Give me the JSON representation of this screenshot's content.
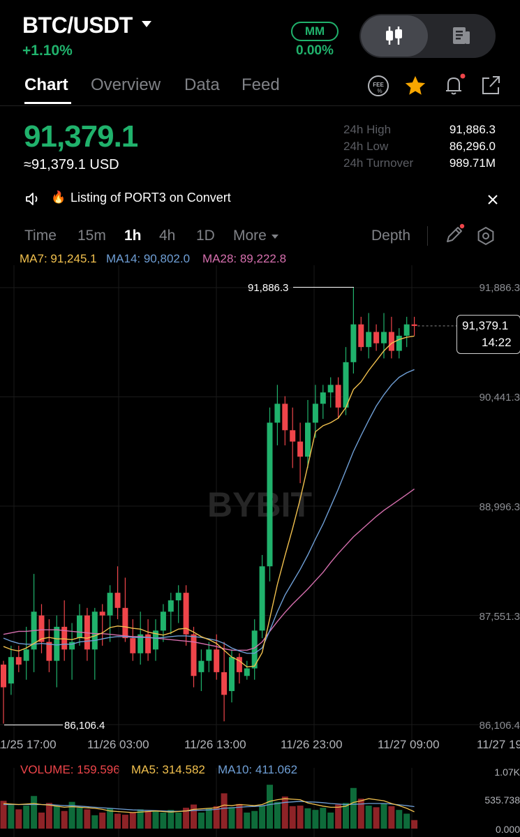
{
  "header": {
    "pair": "BTC/USDT",
    "change": "+1.10%",
    "mm_label": "MM",
    "mm_value": "0.00%"
  },
  "tabs": [
    {
      "label": "Chart"
    },
    {
      "label": "Overview"
    },
    {
      "label": "Data"
    },
    {
      "label": "Feed"
    }
  ],
  "ticker": {
    "last_price": "91,379.1",
    "usd_price": "≈91,379.1 USD",
    "high_label": "24h High",
    "high_value": "91,886.3",
    "low_label": "24h Low",
    "low_value": "86,296.0",
    "turnover_label": "24h Turnover",
    "turnover_value": "989.71M"
  },
  "notice": {
    "text": "Listing of PORT3 on Convert",
    "fire_icon": "🔥"
  },
  "timeframes": {
    "items": [
      "Time",
      "15m",
      "1h",
      "4h",
      "1D",
      "More"
    ],
    "selected": "1h",
    "depth_label": "Depth"
  },
  "ma": {
    "ma7": "MA7: 91,245.1",
    "ma14": "MA14: 90,802.0",
    "ma28": "MA28: 89,222.8"
  },
  "colors": {
    "up": "#20b26c",
    "down": "#ef454a",
    "ma7": "#f2c14e",
    "ma14": "#6f9fd6",
    "ma28": "#d66fae",
    "vol_up": "#0e6b3a",
    "vol_down": "#8e2327"
  },
  "chart_data": {
    "type": "candlestick",
    "y_ticks": [
      "91,886.3",
      "90,441.3",
      "88,996.3",
      "87,551.3",
      "86,106.4"
    ],
    "x_ticks": [
      "11/25 17:00",
      "11/26 03:00",
      "11/26 13:00",
      "11/26 23:00",
      "11/27 09:00",
      "11/27 19"
    ],
    "ylim": [
      86106.4,
      91886.3
    ],
    "max_label": "91,886.3",
    "min_label": "86,106.4",
    "last_price_label": "91,379.1",
    "countdown": "14:22",
    "watermark": "BYBIT",
    "candles": [
      [
        86900,
        86950,
        86120,
        86600
      ],
      [
        86650,
        87150,
        86500,
        87000
      ],
      [
        87000,
        87150,
        86800,
        86900
      ],
      [
        86950,
        87400,
        86700,
        87100
      ],
      [
        87100,
        88100,
        86800,
        87600
      ],
      [
        87550,
        87700,
        87050,
        87200
      ],
      [
        87200,
        87500,
        86800,
        86950
      ],
      [
        86950,
        87550,
        86600,
        87400
      ],
      [
        87400,
        87750,
        86950,
        87100
      ],
      [
        87100,
        87450,
        86700,
        87200
      ],
      [
        87250,
        87700,
        87150,
        87550
      ],
      [
        87550,
        87650,
        86950,
        87100
      ],
      [
        87100,
        87650,
        86700,
        87600
      ],
      [
        87600,
        87700,
        87150,
        87550
      ],
      [
        87550,
        87950,
        87200,
        87850
      ],
      [
        87850,
        88200,
        87500,
        87650
      ],
      [
        87650,
        88050,
        87200,
        87250
      ],
      [
        87250,
        87500,
        86950,
        87050
      ],
      [
        87050,
        87600,
        86900,
        87300
      ],
      [
        87300,
        87500,
        86950,
        87050
      ],
      [
        87100,
        87500,
        86950,
        87350
      ],
      [
        87350,
        87700,
        87200,
        87600
      ],
      [
        87600,
        87850,
        87300,
        87750
      ],
      [
        87750,
        87950,
        87450,
        87850
      ],
      [
        87850,
        87950,
        87150,
        87300
      ],
      [
        87300,
        87400,
        86600,
        86750
      ],
      [
        86800,
        87100,
        86550,
        86950
      ],
      [
        86950,
        87200,
        86800,
        87100
      ],
      [
        87100,
        87300,
        86700,
        86800
      ],
      [
        86800,
        87200,
        86150,
        86500
      ],
      [
        86550,
        87100,
        86400,
        87000
      ],
      [
        87000,
        87050,
        86650,
        86800
      ],
      [
        86750,
        86950,
        86700,
        86850
      ],
      [
        86850,
        87500,
        86700,
        87350
      ],
      [
        87350,
        88350,
        87250,
        88200
      ],
      [
        88200,
        90300,
        88000,
        90100
      ],
      [
        90100,
        90600,
        89800,
        90350
      ],
      [
        90350,
        90450,
        89800,
        90000
      ],
      [
        90000,
        90300,
        89500,
        89850
      ],
      [
        89850,
        90100,
        89300,
        89650
      ],
      [
        89650,
        90400,
        89500,
        90100
      ],
      [
        90100,
        90600,
        89900,
        90350
      ],
      [
        90350,
        90600,
        90150,
        90500
      ],
      [
        90500,
        90700,
        90300,
        90600
      ],
      [
        90600,
        90700,
        90150,
        90300
      ],
      [
        90300,
        91100,
        90200,
        90900
      ],
      [
        90900,
        91886.3,
        90750,
        91400
      ],
      [
        91400,
        91500,
        91050,
        91100
      ],
      [
        91100,
        91550,
        90950,
        91300
      ],
      [
        91300,
        91400,
        91050,
        91150
      ],
      [
        91150,
        91550,
        90950,
        91300
      ],
      [
        91300,
        91500,
        90950,
        91050
      ],
      [
        91050,
        91350,
        90950,
        91250
      ],
      [
        91250,
        91500,
        91100,
        91400
      ],
      [
        91400,
        91500,
        91250,
        91379.1
      ]
    ],
    "ma7": [
      87140,
      87100,
      87080,
      87120,
      87180,
      87240,
      87260,
      87240,
      87240,
      87230,
      87260,
      87250,
      87280,
      87320,
      87390,
      87410,
      87400,
      87380,
      87370,
      87330,
      87310,
      87290,
      87320,
      87370,
      87380,
      87330,
      87270,
      87230,
      87180,
      87090,
      87000,
      86950,
      86870,
      86880,
      87060,
      87510,
      87960,
      88340,
      88700,
      89090,
      89530,
      89980,
      90060,
      90100,
      90160,
      90300,
      90540,
      90640,
      90790,
      90920,
      91050,
      91150,
      91200,
      91230,
      91245.1
    ],
    "ma14": [
      87250,
      87210,
      87180,
      87170,
      87170,
      87180,
      87170,
      87160,
      87170,
      87170,
      87200,
      87210,
      87220,
      87240,
      87260,
      87270,
      87270,
      87260,
      87260,
      87260,
      87250,
      87260,
      87270,
      87280,
      87280,
      87270,
      87260,
      87240,
      87220,
      87180,
      87120,
      87080,
      87050,
      87050,
      87120,
      87350,
      87600,
      87820,
      87990,
      88160,
      88350,
      88560,
      88760,
      88990,
      89220,
      89470,
      89720,
      89930,
      90130,
      90320,
      90470,
      90600,
      90700,
      90760,
      90802.0
    ],
    "ma28": [
      87300,
      87320,
      87340,
      87340,
      87350,
      87360,
      87360,
      87360,
      87350,
      87340,
      87330,
      87320,
      87310,
      87310,
      87300,
      87290,
      87280,
      87270,
      87270,
      87260,
      87250,
      87240,
      87230,
      87220,
      87210,
      87200,
      87180,
      87160,
      87140,
      87110,
      87090,
      87090,
      87090,
      87120,
      87200,
      87340,
      87470,
      87590,
      87700,
      87800,
      87900,
      88010,
      88120,
      88250,
      88370,
      88480,
      88590,
      88680,
      88770,
      88860,
      88940,
      89010,
      89080,
      89150,
      89222.8
    ]
  },
  "volume": {
    "volume_label": "VOLUME: 159.596",
    "ma5_label": "MA5: 314.582",
    "ma10_label": "MA10: 411.062",
    "y_ticks": [
      "1.07K",
      "535.738",
      "0.000"
    ],
    "ylim": [
      0,
      1070
    ],
    "values": [
      520,
      440,
      360,
      430,
      610,
      300,
      480,
      420,
      330,
      500,
      390,
      360,
      250,
      300,
      380,
      280,
      260,
      300,
      360,
      330,
      320,
      300,
      350,
      300,
      390,
      450,
      300,
      380,
      420,
      660,
      400,
      460,
      300,
      330,
      430,
      820,
      500,
      600,
      420,
      430,
      380,
      350,
      390,
      300,
      450,
      480,
      760,
      560,
      430,
      400,
      470,
      420,
      350,
      280,
      159.596
    ],
    "ma5": [
      470,
      460,
      450,
      460,
      470,
      450,
      440,
      420,
      400,
      410,
      400,
      390,
      380,
      360,
      330,
      320,
      310,
      300,
      310,
      320,
      330,
      320,
      310,
      320,
      330,
      360,
      370,
      380,
      390,
      440,
      430,
      450,
      440,
      430,
      450,
      510,
      540,
      560,
      550,
      540,
      480,
      450,
      420,
      400,
      400,
      420,
      490,
      520,
      560,
      540,
      520,
      470,
      430,
      380,
      314.582
    ],
    "ma10": [
      450,
      450,
      450,
      450,
      450,
      450,
      450,
      440,
      430,
      430,
      420,
      410,
      400,
      390,
      380,
      370,
      360,
      350,
      345,
      340,
      335,
      330,
      325,
      325,
      330,
      340,
      345,
      350,
      360,
      380,
      390,
      400,
      410,
      415,
      425,
      450,
      470,
      490,
      500,
      510,
      500,
      495,
      485,
      470,
      460,
      450,
      455,
      460,
      470,
      470,
      470,
      460,
      445,
      430,
      411.062
    ]
  }
}
